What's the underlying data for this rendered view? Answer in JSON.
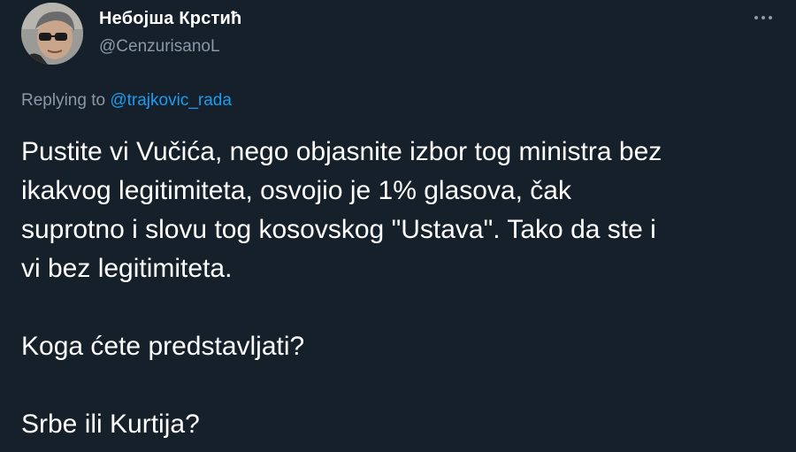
{
  "author": {
    "display_name": "Небојша Крстић",
    "handle": "@CenzurisanoL",
    "avatar_icon": "profile-photo"
  },
  "more_icon": "ellipsis-icon",
  "reply": {
    "prefix": "Replying to",
    "mention": "@trajkovic_rada"
  },
  "content": {
    "lines_p1": [
      "Pustite vi Vučića, nego objasnite izbor tog ministra bez",
      "ikakvog legitimiteta, osvojio je 1% glasova, čak",
      "suprotno i slovu tog kosovskog \"Ustava\". Tako da ste i",
      "vi bez legitimiteta."
    ],
    "p2": "Koga ćete predstavljati?",
    "p3": "Srbe ili Kurtija?"
  },
  "colors": {
    "background": "#15202b",
    "text": "#ffffff",
    "secondary": "#8b98a5",
    "link": "#1d9bf0"
  }
}
